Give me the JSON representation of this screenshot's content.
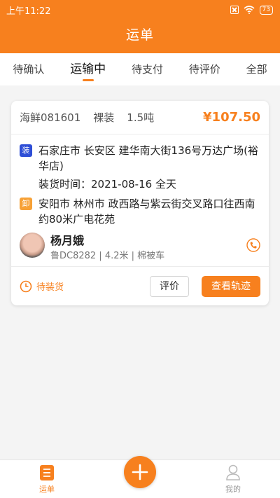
{
  "status_bar": {
    "time": "上午11:22",
    "battery": "73",
    "icons": [
      "sim-icon",
      "wifi-icon",
      "battery-icon"
    ]
  },
  "header": {
    "title": "运单"
  },
  "tabs": [
    {
      "label": "待确认",
      "active": false
    },
    {
      "label": "运输中",
      "active": true
    },
    {
      "label": "待支付",
      "active": false
    },
    {
      "label": "待评价",
      "active": false
    },
    {
      "label": "全部",
      "active": false
    }
  ],
  "order": {
    "cargo_name": "海鲜081601",
    "packing": "裸装",
    "weight": "1.5吨",
    "price": "¥107.50",
    "load": {
      "badge": "装",
      "address": "石家庄市 长安区 建华南大街136号万达广场(裕华店)",
      "time": "装货时间：2021-08-16 全天"
    },
    "unload": {
      "badge": "卸",
      "address": "安阳市 林州市 政西路与紫云街交叉路口往西南约80米广电花苑"
    },
    "driver": {
      "name": "杨月娥",
      "vehicle": "鲁DC8282 | 4.2米 | 棉被车"
    },
    "status": "待装货",
    "rate_button": "评价",
    "track_button": "查看轨迹"
  },
  "bottom_nav": [
    {
      "label": "运单",
      "icon": "waybill-icon",
      "active": true
    },
    {
      "label": "我的",
      "icon": "person-icon",
      "active": false
    }
  ],
  "fab": {
    "icon": "plus-icon"
  },
  "colors": {
    "accent": "#f7801e",
    "load_badge": "#2e4ed6",
    "unload_badge": "#f7a136"
  }
}
